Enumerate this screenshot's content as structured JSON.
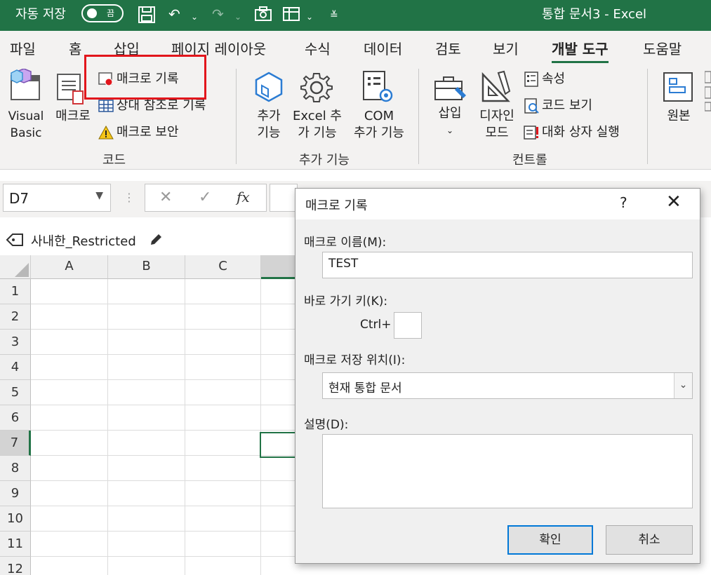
{
  "titlebar": {
    "autosave_label": "자동 저장",
    "autosave_state": "끔",
    "doc_title": "통합 문서3  -  Excel"
  },
  "tabs": [
    "파일",
    "홈",
    "삽입",
    "페이지 레이아웃",
    "수식",
    "데이터",
    "검토",
    "보기",
    "개발 도구",
    "도움말"
  ],
  "active_tab": "개발 도구",
  "ribbon": {
    "code": {
      "group_label": "코드",
      "visual_basic": "Visual\nBasic",
      "macro": "매크로",
      "record_macro": "매크로 기록",
      "relative_ref": "상대 참조로 기록",
      "macro_security": "매크로 보안"
    },
    "addins": {
      "group_label": "추가 기능",
      "addins": "추가\n기능",
      "excel_addins": "Excel 추\n가 기능",
      "com_addins": "COM\n추가 기능"
    },
    "controls": {
      "group_label": "컨트롤",
      "insert": "삽입",
      "design_mode": "디자인\n모드",
      "properties": "속성",
      "view_code": "코드 보기",
      "run_dialog": "대화 상자 실행"
    },
    "xml": {
      "source": "원본"
    }
  },
  "formula_bar": {
    "name_box": "D7",
    "fx": "fx"
  },
  "sensitivity": {
    "label": "사내한_Restricted"
  },
  "grid": {
    "columns": [
      "A",
      "B",
      "C"
    ],
    "rows": [
      "1",
      "2",
      "3",
      "4",
      "5",
      "6",
      "7",
      "8",
      "9",
      "10",
      "11",
      "12"
    ]
  },
  "dialog": {
    "title": "매크로 기록",
    "help": "?",
    "close": "✕",
    "macro_name_label": "매크로 이름(M):",
    "macro_name_value": "TEST",
    "shortcut_label": "바로 가기 키(K):",
    "shortcut_prefix": "Ctrl+",
    "shortcut_value": "",
    "store_in_label": "매크로 저장 위치(I):",
    "store_in_value": "현재 통합 문서",
    "description_label": "설명(D):",
    "description_value": "",
    "ok": "확인",
    "cancel": "취소"
  },
  "colors": {
    "excel_green": "#217346",
    "highlight_red": "#e2161c",
    "primary_border": "#0078d7"
  }
}
